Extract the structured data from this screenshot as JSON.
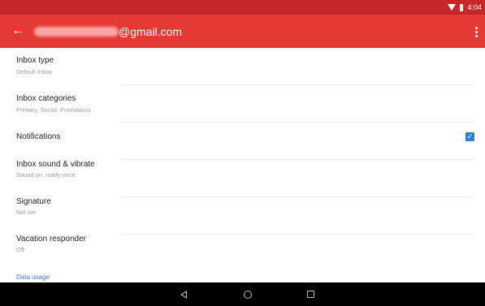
{
  "status_bar": {
    "time": "4:04",
    "icons": [
      "wifi-icon",
      "battery-icon"
    ]
  },
  "app_bar": {
    "back_icon": "arrow-back-icon",
    "account_visible": "@gmail.com",
    "menu_icon": "overflow-menu-icon",
    "color": "#e53935"
  },
  "settings": [
    {
      "title": "Inbox type",
      "summary": "Default Inbox"
    },
    {
      "title": "Inbox categories",
      "summary": "Primary, Social, Promotions"
    },
    {
      "title": "Notifications",
      "summary": "",
      "checked": true
    },
    {
      "title": "Inbox sound & vibrate",
      "summary": "Sound on, notify once"
    },
    {
      "title": "Signature",
      "summary": "Not set"
    },
    {
      "title": "Vacation responder",
      "summary": "Off"
    }
  ],
  "footer_link": "Data usage",
  "nav_bar": {
    "buttons": [
      "back-triangle-icon",
      "home-circle-icon",
      "recents-square-icon"
    ]
  },
  "colors": {
    "accent": "#2f7fd3",
    "status_bar": "#c62828"
  }
}
